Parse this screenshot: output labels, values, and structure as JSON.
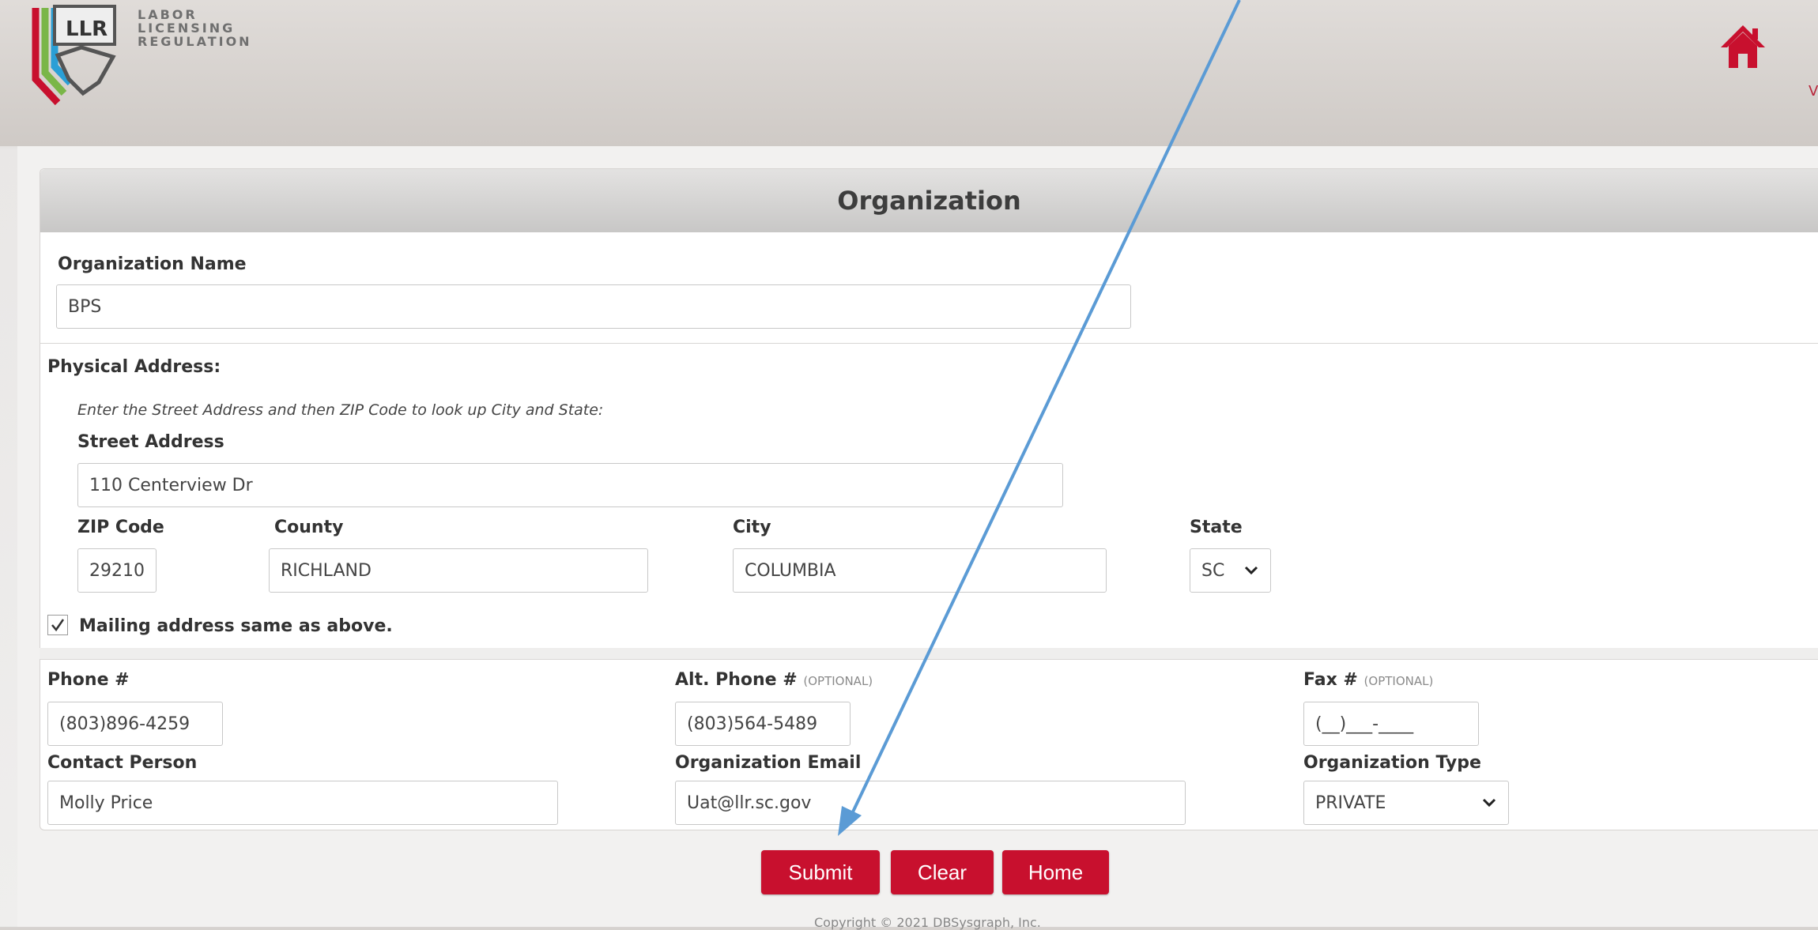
{
  "brand": {
    "line1": "LABOR",
    "line2": "LICENSING",
    "line3": "REGULATION",
    "logo_text": "LLR"
  },
  "header": {
    "home_icon": "home-icon",
    "edge_text": "V"
  },
  "form": {
    "title": "Organization",
    "org_name": {
      "label": "Organization Name",
      "value": "BPS"
    },
    "physical_address": {
      "heading": "Physical Address:",
      "hint": "Enter the Street Address and then ZIP Code to look up City and State:",
      "street": {
        "label": "Street Address",
        "value": "110 Centerview Dr"
      },
      "zip": {
        "label": "ZIP Code",
        "value": "29210"
      },
      "county": {
        "label": "County",
        "value": "RICHLAND"
      },
      "city": {
        "label": "City",
        "value": "COLUMBIA"
      },
      "state": {
        "label": "State",
        "value": "SC"
      }
    },
    "mailing_same": {
      "label": "Mailing address same as above.",
      "checked": true
    },
    "phone": {
      "label": "Phone #",
      "value": "(803)896-4259"
    },
    "alt_phone": {
      "label": "Alt. Phone #",
      "optional": "(OPTIONAL)",
      "value": "(803)564-5489"
    },
    "fax": {
      "label": "Fax #",
      "optional": "(OPTIONAL)",
      "value": "(__)___-____"
    },
    "contact": {
      "label": "Contact Person",
      "value": "Molly Price"
    },
    "email": {
      "label": "Organization Email",
      "value": "Uat@llr.sc.gov"
    },
    "org_type": {
      "label": "Organization Type",
      "value": "PRIVATE"
    }
  },
  "buttons": {
    "submit": "Submit",
    "clear": "Clear",
    "home": "Home"
  },
  "footer": {
    "copyright": "Copyright © 2021 DBSysgraph, Inc."
  },
  "colors": {
    "accent": "#c8102e",
    "annotation_arrow": "#5b9bd5"
  }
}
